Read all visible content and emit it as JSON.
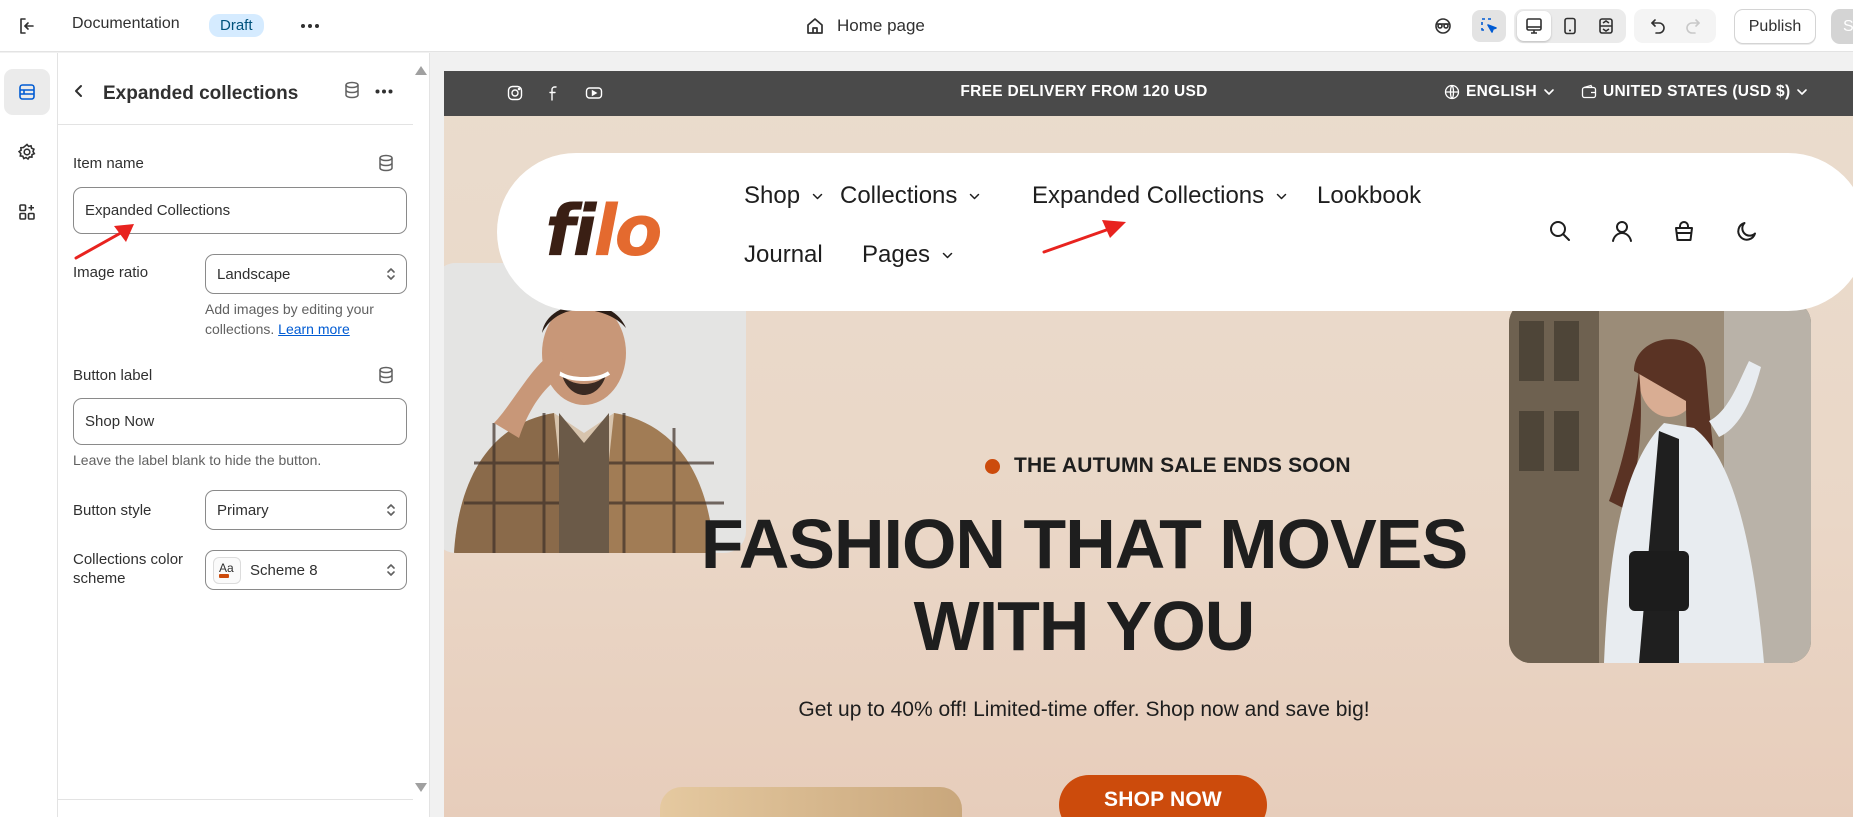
{
  "topbar": {
    "doc_title": "Documentation",
    "status_badge": "Draft",
    "page_name": "Home page",
    "publish_label": "Publish",
    "save_label": "S"
  },
  "panel": {
    "title": "Expanded collections",
    "item_name_label": "Item name",
    "item_name_value": "Expanded Collections",
    "image_ratio_label": "Image ratio",
    "image_ratio_value": "Landscape",
    "image_ratio_help": "Add images by editing your collections.",
    "image_ratio_help_link": "Learn more",
    "button_label_label": "Button label",
    "button_label_value": "Shop Now",
    "button_label_help": "Leave the label blank to hide the button.",
    "button_style_label": "Button style",
    "button_style_value": "Primary",
    "color_scheme_label": "Collections color scheme",
    "color_scheme_value": "Scheme 8",
    "color_scheme_swatch_text": "Aa"
  },
  "preview": {
    "announcement": "FREE DELIVERY FROM 120 USD",
    "language": "ENGLISH",
    "currency": "UNITED STATES (USD $)",
    "logo_part1": "fi",
    "logo_part2": "lo",
    "nav": {
      "shop": "Shop",
      "collections": "Collections",
      "expanded_collections": "Expanded Collections",
      "lookbook": "Lookbook",
      "journal": "Journal",
      "pages": "Pages"
    },
    "eyebrow": "THE AUTUMN SALE ENDS SOON",
    "headline_line1": "FASHION THAT MOVES",
    "headline_line2": "WITH YOU",
    "subtext": "Get up to 40% off! Limited-time offer. Shop now and save big!",
    "cta": "SHOP NOW"
  },
  "colors": {
    "accent_orange": "#cc4b0c",
    "annotation_arrow": "#e8231f",
    "badge_bg": "#d5ebff",
    "link": "#005bd3"
  },
  "icons": {
    "topbar": [
      "exit-icon",
      "more-horizontal-icon",
      "home-icon",
      "theme-inspector-icon",
      "select-element-icon",
      "desktop-icon",
      "mobile-icon",
      "fullwidth-icon",
      "undo-icon",
      "redo-icon"
    ],
    "rail": [
      "sections-icon",
      "settings-gear-icon",
      "apps-icon"
    ],
    "preview": [
      "instagram-icon",
      "facebook-icon",
      "youtube-icon",
      "globe-icon",
      "wallet-icon",
      "search-icon",
      "account-icon",
      "cart-icon",
      "dark-mode-icon"
    ]
  }
}
